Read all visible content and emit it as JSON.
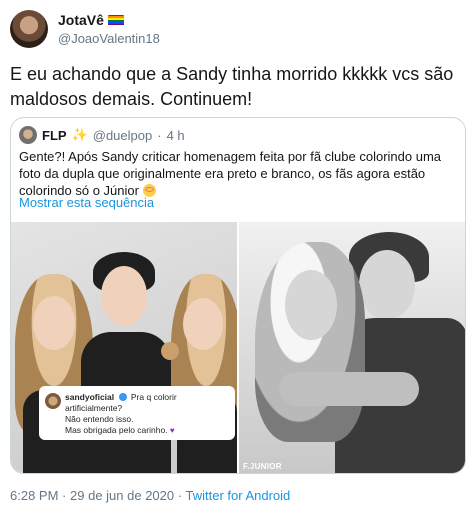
{
  "tweet": {
    "author": {
      "display_name": "JotaVê",
      "handle": "@JoaoValentin18",
      "flag_colors": [
        "#e40303",
        "#ff8c00",
        "#ffed00",
        "#008026",
        "#004dff",
        "#750787"
      ]
    },
    "text": "E eu achando que a Sandy tinha morrido kkkkk vcs são maldosos demais. Continuem!",
    "time": "6:28 PM",
    "separator": "·",
    "date": "29 de jun de 2020",
    "source": "Twitter for Android"
  },
  "quote": {
    "author": {
      "display_name": "FLP",
      "badge_icon": "sparkle-icon",
      "handle": "@duelpop",
      "separator": "·",
      "time": "4 h"
    },
    "text": "Gente?! Após Sandy criticar homenagem feita por fã clube colorindo uma foto da dupla que originalmente era preto e branco, os fãs agora estão colorindo só o Júnior",
    "show_thread": "Mostrar esta sequência",
    "image_left": {
      "comment_user": "sandyoficial",
      "comment_text": "Pra q colorir artificialmente?",
      "comment_line2": "Não entendo isso.",
      "comment_line3": "Mas obrigada pelo carinho."
    },
    "image_right": {
      "watermark": "F.JUNIOR"
    }
  },
  "colors": {
    "link": "#1b95e0",
    "muted": "#657786",
    "border": "#ccd6dd",
    "text": "#14171a"
  }
}
